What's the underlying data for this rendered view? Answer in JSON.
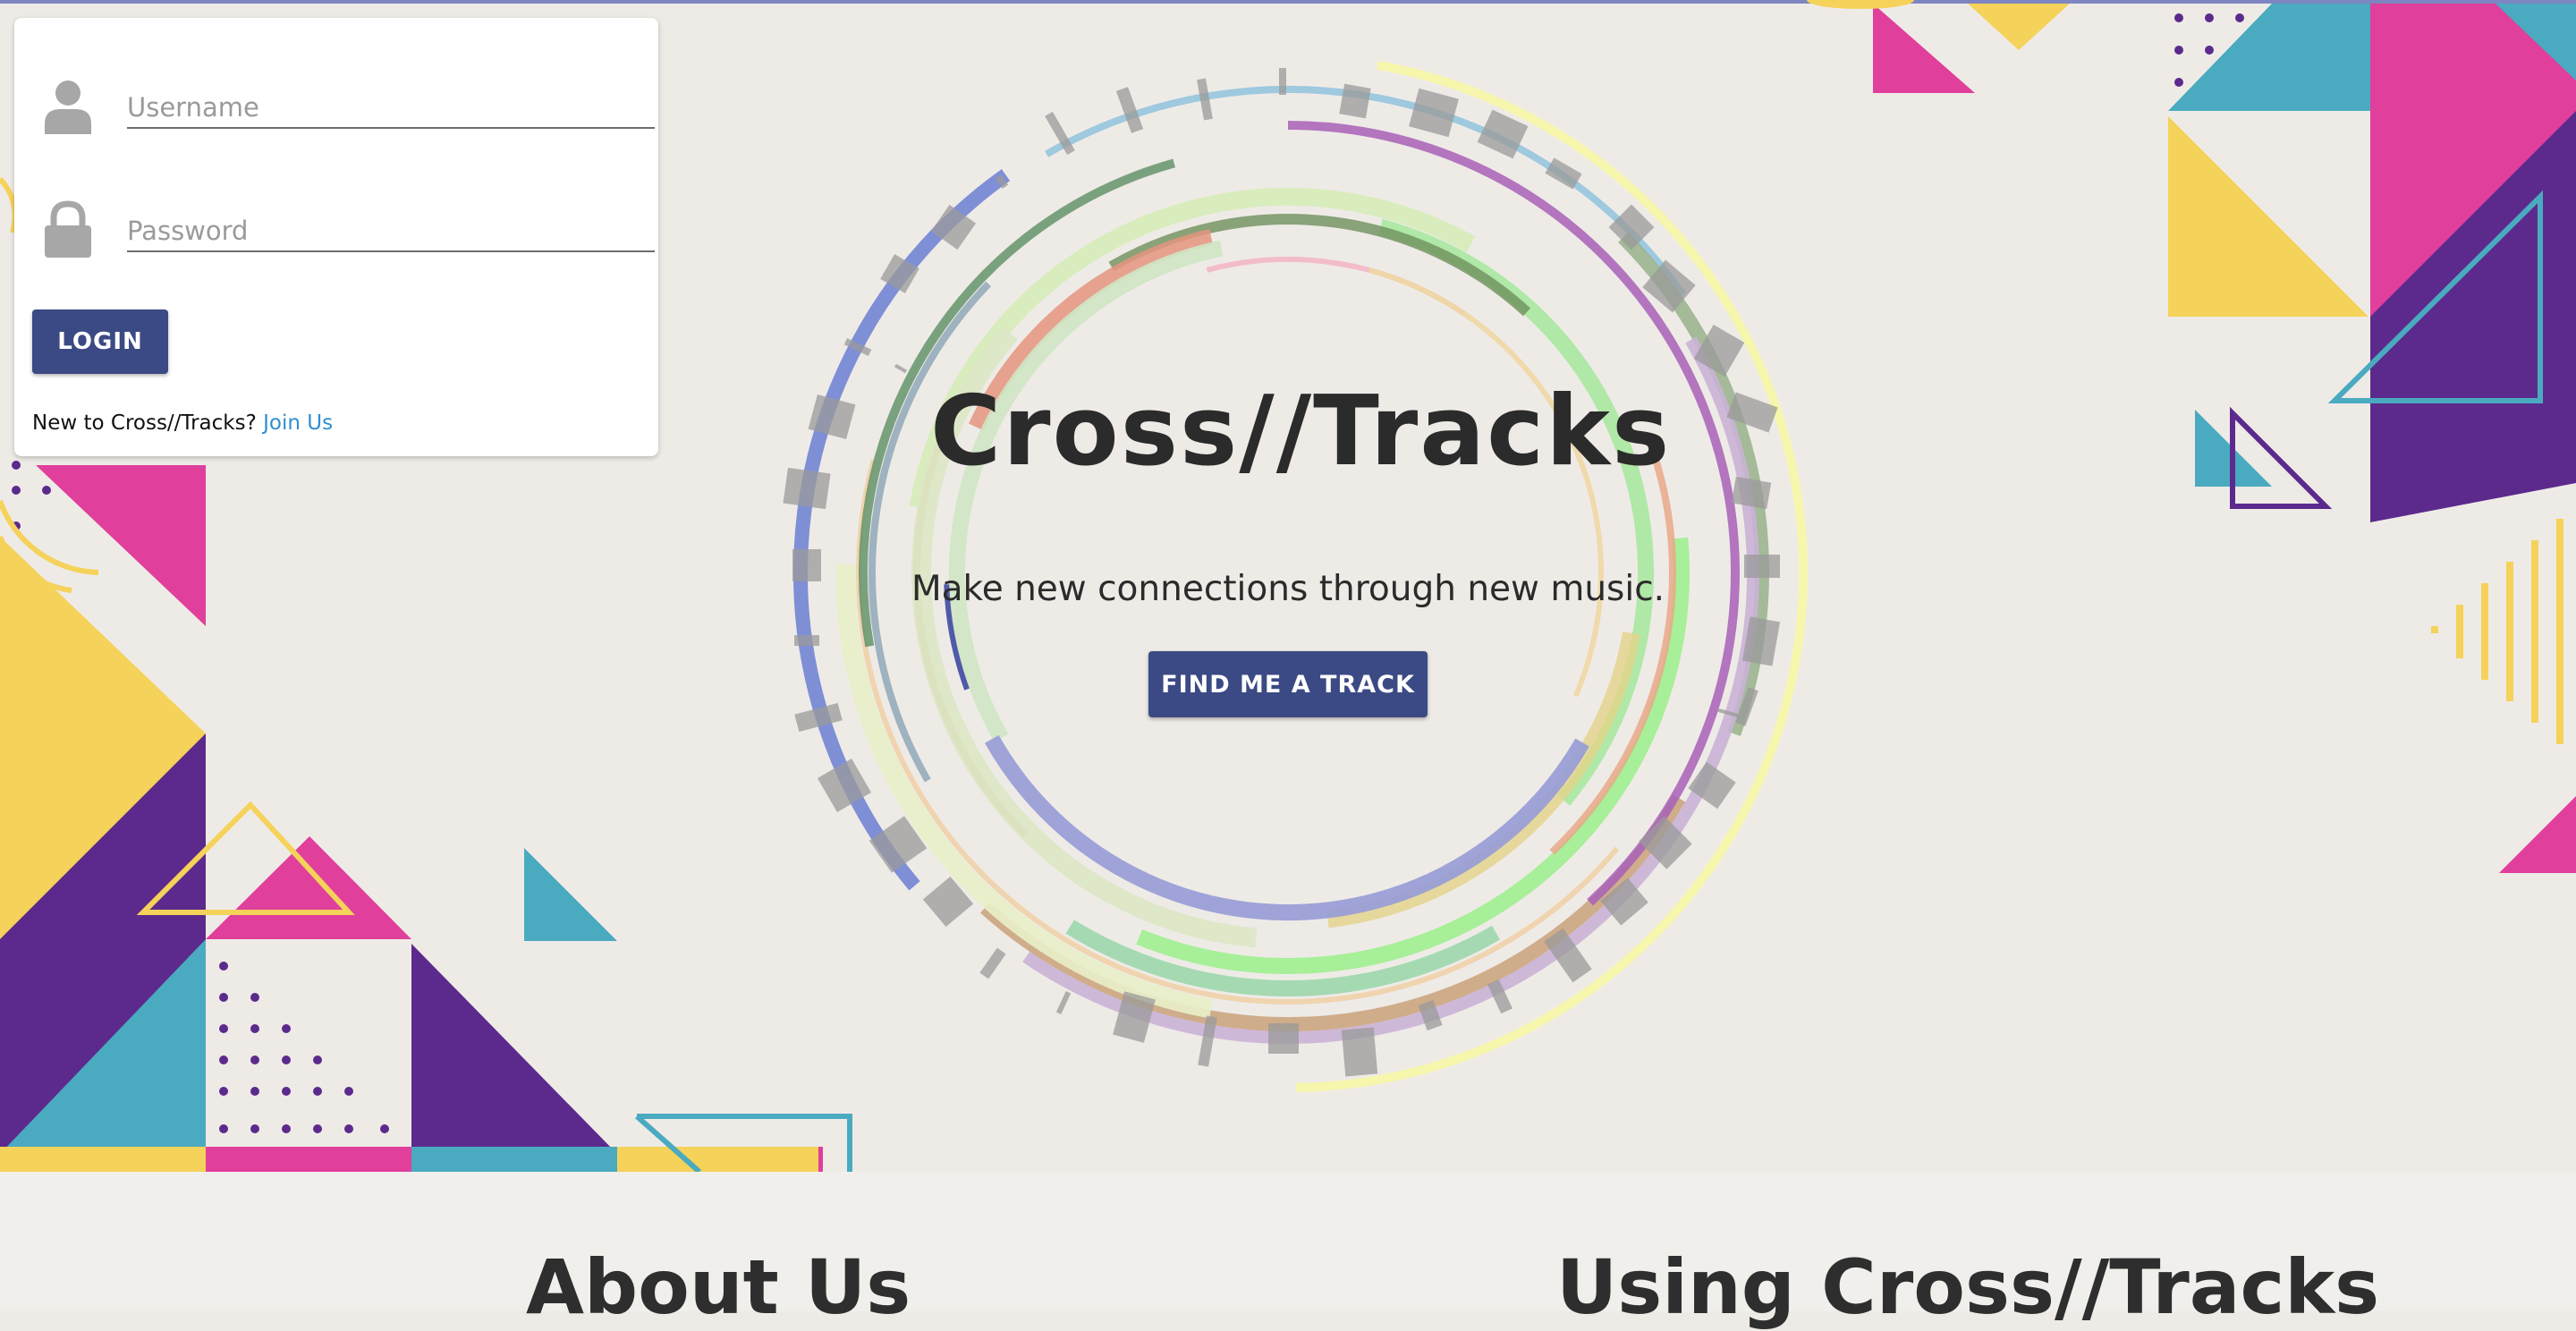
{
  "app": {
    "title": "Cross//Tracks",
    "tagline": "Make new connections through new music.",
    "cta_label": "FIND ME A TRACK"
  },
  "login": {
    "username_placeholder": "Username",
    "password_placeholder": "Password",
    "login_label": "LOGIN",
    "signup_prompt": "New to Cross//Tracks?",
    "signup_link": "Join Us"
  },
  "sections": {
    "about_title": "About Us",
    "using_title": "Using Cross//Tracks"
  },
  "icons": {
    "username": "user-icon",
    "password": "lock-icon"
  },
  "colors": {
    "accent": "#3b4a84",
    "link": "#2f8fd0",
    "magenta": "#e03f9b",
    "purple": "#5c2a8c",
    "teal": "#4aaac0",
    "yellow": "#f5d25a",
    "background": "#eeebe7"
  }
}
